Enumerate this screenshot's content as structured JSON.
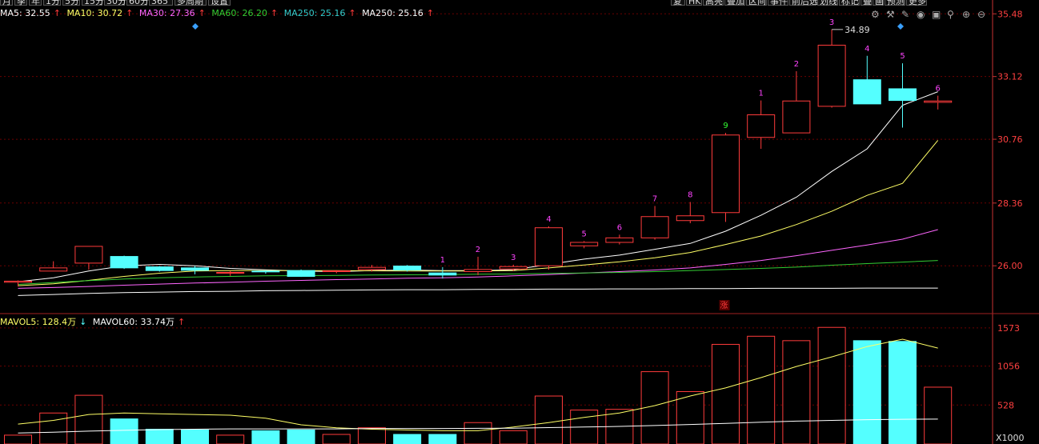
{
  "toolbar": {
    "left_tabs": [
      "月",
      "季",
      "年",
      "1分",
      "5分",
      "15分",
      "30分",
      "60分",
      "365",
      "多周期",
      "设置"
    ],
    "right_tabs": [
      "复",
      "HK",
      "高亮",
      "叠加",
      "区间",
      "事件",
      "前后选",
      "划线",
      "标记",
      "叠",
      "画",
      "预测",
      "更多"
    ]
  },
  "legend_price": {
    "ma5": "MA5: 32.55",
    "ma5_arrow": "↑",
    "ma10": "MA10: 30.72",
    "ma10_arrow": "↑",
    "ma30": "MA30: 27.36",
    "ma30_arrow": "↑",
    "ma60": "MA60: 26.20",
    "ma60_arrow": "↑",
    "ma250a": "MA250: 25.16",
    "ma250a_arrow": "↑",
    "ma250b": "MA250: 25.16",
    "ma250b_arrow": "↑"
  },
  "legend_volume": {
    "mavol5": "MAVOL5: 128.4万",
    "mavol5_arrow": "↓",
    "mavol60": "MAVOL60: 33.74万",
    "mavol60_arrow": "↑"
  },
  "controls": [
    "gear-icon",
    "tool-icon",
    "pen-icon",
    "eye-icon",
    "bag-icon",
    "pin-icon",
    "plus-icon",
    "minus-icon"
  ],
  "colors": {
    "up": "#ff3b3b",
    "down": "#54ffff",
    "ma5": "#ffffff",
    "ma10": "#ffff66",
    "ma30": "#ff66ff",
    "ma60": "#33cc33",
    "ma250": "#ffffff",
    "grid": "#6b0000",
    "axis": "#ff4040",
    "count": "#ff44ff",
    "count9": "#33ff33"
  },
  "chart_data": {
    "type": "candlestick",
    "price_axis": {
      "ticks": [
        "35.48",
        "33.12",
        "30.76",
        "28.36",
        "26.00"
      ],
      "ylim": [
        24.2,
        36.0
      ]
    },
    "volume_axis": {
      "ticks": [
        "1573",
        "1056",
        "528"
      ],
      "unit": "X1000",
      "ylim": [
        0,
        1680
      ]
    },
    "candles": [
      {
        "o": 25.38,
        "h": 25.45,
        "l": 25.22,
        "c": 25.42,
        "v": 120,
        "label": ""
      },
      {
        "o": 25.8,
        "h": 26.17,
        "l": 25.8,
        "c": 25.92,
        "v": 420,
        "label": ""
      },
      {
        "o": 26.1,
        "h": 26.6,
        "l": 25.85,
        "c": 26.73,
        "v": 660,
        "label": ""
      },
      {
        "o": 26.35,
        "h": 26.38,
        "l": 25.88,
        "c": 25.92,
        "v": 340,
        "label": ""
      },
      {
        "o": 25.96,
        "h": 25.99,
        "l": 25.78,
        "c": 25.82,
        "v": 200,
        "label": ""
      },
      {
        "o": 25.92,
        "h": 25.99,
        "l": 25.68,
        "c": 25.83,
        "v": 190,
        "label": ""
      },
      {
        "o": 25.72,
        "h": 25.8,
        "l": 25.62,
        "c": 25.75,
        "v": 120,
        "label": ""
      },
      {
        "o": 25.8,
        "h": 25.82,
        "l": 25.7,
        "c": 25.79,
        "v": 180,
        "label": ""
      },
      {
        "o": 25.82,
        "h": 25.86,
        "l": 25.58,
        "c": 25.6,
        "v": 190,
        "label": ""
      },
      {
        "o": 25.8,
        "h": 25.83,
        "l": 25.72,
        "c": 25.81,
        "v": 130,
        "label": ""
      },
      {
        "o": 25.86,
        "h": 26.03,
        "l": 25.78,
        "c": 25.94,
        "v": 220,
        "label": ""
      },
      {
        "o": 25.99,
        "h": 26.03,
        "l": 25.78,
        "c": 25.84,
        "v": 130,
        "label": ""
      },
      {
        "o": 25.73,
        "h": 25.95,
        "l": 25.52,
        "c": 25.65,
        "v": 130,
        "label": "1"
      },
      {
        "o": 25.78,
        "h": 26.34,
        "l": 25.65,
        "c": 25.86,
        "v": 290,
        "label": "2"
      },
      {
        "o": 25.88,
        "h": 26.04,
        "l": 25.8,
        "c": 25.97,
        "v": 180,
        "label": "3"
      },
      {
        "o": 26.0,
        "h": 27.48,
        "l": 25.85,
        "c": 27.43,
        "v": 650,
        "label": "4"
      },
      {
        "o": 26.75,
        "h": 26.93,
        "l": 26.66,
        "c": 26.88,
        "v": 460,
        "label": "5"
      },
      {
        "o": 26.88,
        "h": 27.17,
        "l": 26.8,
        "c": 27.05,
        "v": 470,
        "label": "6"
      },
      {
        "o": 27.05,
        "h": 28.25,
        "l": 26.98,
        "c": 27.85,
        "v": 980,
        "label": "7"
      },
      {
        "o": 27.7,
        "h": 28.4,
        "l": 27.6,
        "c": 27.88,
        "v": 710,
        "label": "8"
      },
      {
        "o": 28.0,
        "h": 31.0,
        "l": 27.65,
        "c": 30.92,
        "v": 1350,
        "label": "9"
      },
      {
        "o": 30.83,
        "h": 32.22,
        "l": 30.4,
        "c": 31.68,
        "v": 1460,
        "label": "1"
      },
      {
        "o": 31.0,
        "h": 33.32,
        "l": 31.0,
        "c": 32.2,
        "v": 1400,
        "label": "2"
      },
      {
        "o": 32.0,
        "h": 34.89,
        "l": 31.95,
        "c": 34.3,
        "v": 1580,
        "label": "3"
      },
      {
        "o": 33.0,
        "h": 33.9,
        "l": 32.26,
        "c": 32.09,
        "v": 1400,
        "label": "4"
      },
      {
        "o": 32.66,
        "h": 33.62,
        "l": 31.2,
        "c": 32.22,
        "v": 1390,
        "label": "5"
      },
      {
        "o": 32.15,
        "h": 32.4,
        "l": 31.88,
        "c": 32.2,
        "v": 770,
        "label": "6"
      }
    ],
    "high_mark": {
      "label": "34.89",
      "index": 23
    },
    "signal_label": "涨",
    "ma_lines": {
      "ma5": [
        25.4,
        25.55,
        25.8,
        26.0,
        26.05,
        26.0,
        25.9,
        25.85,
        25.8,
        25.78,
        25.82,
        25.84,
        25.82,
        25.82,
        25.85,
        26.05,
        26.25,
        26.4,
        26.62,
        26.84,
        27.3,
        27.9,
        28.58,
        29.55,
        30.4,
        32.04,
        32.55
      ],
      "ma10": [
        25.25,
        25.32,
        25.45,
        25.6,
        25.72,
        25.8,
        25.82,
        25.82,
        25.82,
        25.82,
        25.81,
        25.8,
        25.8,
        25.8,
        25.82,
        25.92,
        26.03,
        26.15,
        26.3,
        26.5,
        26.8,
        27.12,
        27.55,
        28.05,
        28.65,
        29.1,
        30.72
      ],
      "ma30": [
        25.15,
        25.18,
        25.22,
        25.27,
        25.31,
        25.35,
        25.38,
        25.42,
        25.45,
        25.48,
        25.5,
        25.53,
        25.55,
        25.58,
        25.62,
        25.67,
        25.73,
        25.78,
        25.84,
        25.92,
        26.05,
        26.2,
        26.38,
        26.58,
        26.78,
        27.0,
        27.36
      ],
      "ma60": [
        25.3,
        25.37,
        25.44,
        25.5,
        25.55,
        25.58,
        25.6,
        25.62,
        25.63,
        25.64,
        25.65,
        25.66,
        25.67,
        25.68,
        25.69,
        25.71,
        25.73,
        25.75,
        25.78,
        25.82,
        25.86,
        25.9,
        25.95,
        26.02,
        26.08,
        26.14,
        26.2
      ],
      "ma250": [
        24.88,
        24.92,
        24.96,
        24.99,
        25.01,
        25.03,
        25.04,
        25.06,
        25.07,
        25.08,
        25.09,
        25.1,
        25.1,
        25.11,
        25.11,
        25.12,
        25.12,
        25.13,
        25.13,
        25.14,
        25.14,
        25.15,
        25.15,
        25.15,
        25.16,
        25.16,
        25.16
      ]
    },
    "vol_lines": {
      "mavol5": [
        270,
        320,
        400,
        420,
        410,
        400,
        390,
        350,
        260,
        220,
        200,
        190,
        180,
        180,
        230,
        290,
        360,
        420,
        520,
        650,
        760,
        900,
        1050,
        1180,
        1320,
        1420,
        1300
      ],
      "mavol60": [
        150,
        160,
        175,
        185,
        195,
        200,
        205,
        205,
        205,
        205,
        210,
        210,
        210,
        212,
        215,
        222,
        230,
        238,
        250,
        265,
        280,
        295,
        310,
        320,
        330,
        335,
        337
      ]
    }
  }
}
